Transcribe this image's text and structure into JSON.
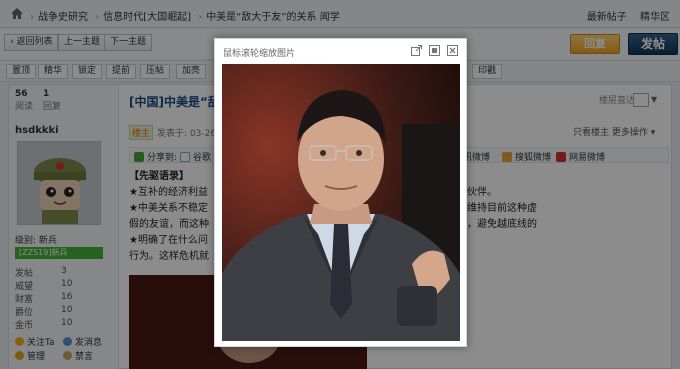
{
  "breadcrumb": {
    "items": [
      "战争史研究",
      "信息时代[大国崛起]",
      "中美是“敌大于友”的关系 闻学"
    ]
  },
  "top_links": [
    "最新帖子",
    "精华区"
  ],
  "nav_buttons": [
    "返回列表",
    "上一主题",
    "下一主题"
  ],
  "reply_label": "回复",
  "post_label": "发帖",
  "mod_buttons": [
    "置顶",
    "精华",
    "锁定",
    "提前",
    "压帖",
    "加亮",
    "印戳"
  ],
  "stats": {
    "reads": "56",
    "reads_label": "阅读",
    "replies": "1",
    "replies_label": "回复"
  },
  "thread": {
    "title": "[中国]中美是“敌",
    "poster_badge": "楼主",
    "posted": "发表于: 03-26 , IP",
    "only_author": "只看楼主",
    "more_actions": "更多操作",
    "view_mode": "楼层直达"
  },
  "user": {
    "name": "hsdkkki",
    "level_label": "级别: 新兵",
    "level_bar": "[ZZS19]新兵",
    "profile": [
      {
        "k": "发帖",
        "v": "3"
      },
      {
        "k": "威望",
        "v": "10"
      },
      {
        "k": "财富",
        "v": "16"
      },
      {
        "k": "爵位",
        "v": "10"
      },
      {
        "k": "金币",
        "v": "10"
      }
    ],
    "actions": [
      "关注Ta",
      "发消息",
      "管理",
      "禁言"
    ]
  },
  "share": {
    "label": "分享到:",
    "items": [
      "谷歌",
      "腾讯微博",
      "搜狐微博",
      "网易微博"
    ]
  },
  "post_lines": [
    "【先驱语录】",
    "★互补的经济利益",
    "★中美关系不稳定",
    "假的友谊，而这种",
    "★明确了在什么问",
    "行为。这样危机就"
  ],
  "post_lines_right": [
    "者，还不是共同投资的合作伙伴。",
    "益大于共同利益。双方都想维持目前这种虚",
    "",
    "于双方理解对方的政策底线，避免越底线的"
  ],
  "popup": {
    "title": "鼠标滚轮缩放图片"
  },
  "colors": {
    "reply": "#f1a425",
    "post": "#12365a",
    "link": "#1a4d85",
    "level": "#44b33a"
  }
}
